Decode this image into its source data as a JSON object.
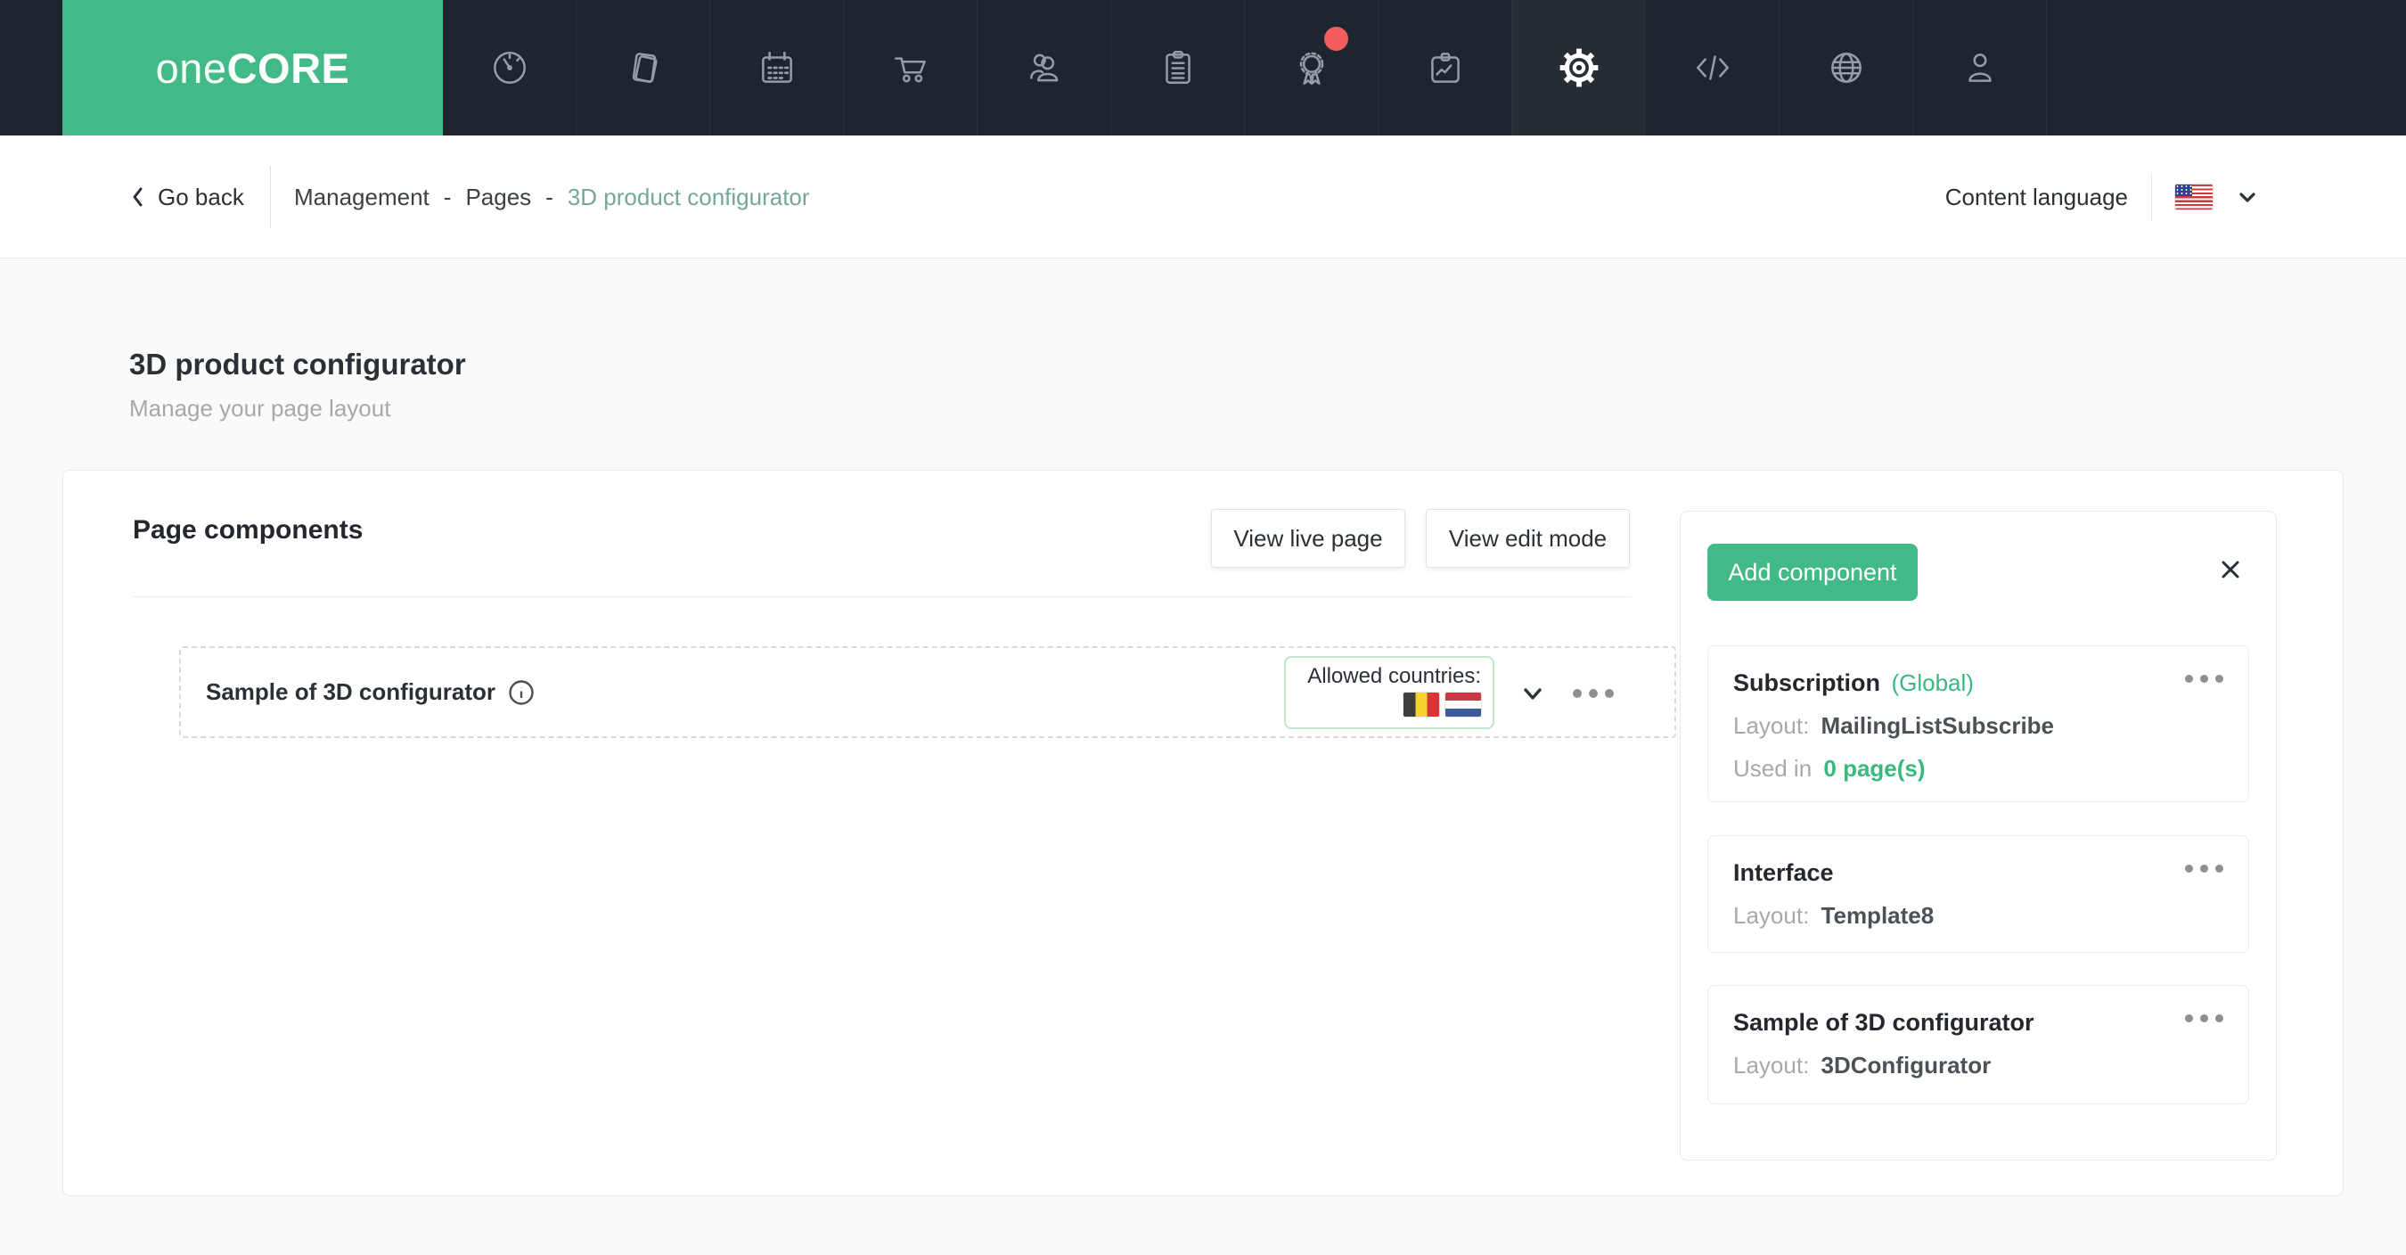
{
  "brand": {
    "prefix": "one",
    "name": "CORE"
  },
  "nav": {
    "icons": [
      "dashboard-icon",
      "pages-icon",
      "calendar-icon",
      "cart-icon",
      "users-icon",
      "orders-icon",
      "rewards-icon",
      "reports-icon",
      "settings-icon",
      "code-icon",
      "globe-icon",
      "account-icon"
    ],
    "active_tab": "settings",
    "notification_color": "#f25c5c"
  },
  "header": {
    "go_back": "Go back",
    "breadcrumb": [
      "Management",
      "Pages",
      "3D product configurator"
    ],
    "separator": "-",
    "content_language_label": "Content language",
    "language_flag": "us-flag"
  },
  "page": {
    "title": "3D product configurator",
    "subtitle": "Manage your page layout"
  },
  "components_section": {
    "heading": "Page components",
    "view_live_label": "View live page",
    "view_edit_label": "View edit mode",
    "row": {
      "title": "Sample of 3D configurator",
      "allowed_countries_label": "Allowed countries:",
      "allowed_countries": [
        "Belgium",
        "Netherlands"
      ]
    }
  },
  "sidebar": {
    "add_component_label": "Add component",
    "components": [
      {
        "name": "Subscription",
        "tag": "(Global)",
        "layout_label": "Layout:",
        "layout": "MailingListSubscribe",
        "used_in_label": "Used in",
        "used_in_value": "0 page(s)"
      },
      {
        "name": "Interface",
        "layout_label": "Layout:",
        "layout": "Template8"
      },
      {
        "name": "Sample of 3D configurator",
        "layout_label": "Layout:",
        "layout": "3DConfigurator"
      }
    ]
  },
  "colors": {
    "brand_green": "#41ba87",
    "nav_bg": "#1f252e",
    "accent_text_green": "#38b97e",
    "breadcrumb_active": "#74a79c",
    "notification_red": "#f25c5c"
  }
}
